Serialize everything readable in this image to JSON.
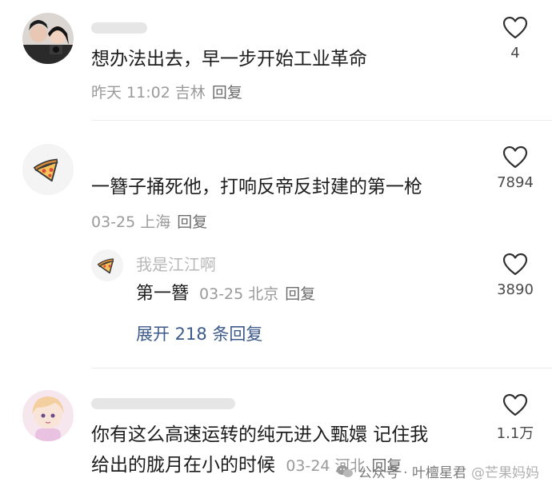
{
  "comments": [
    {
      "content": "想办法出去，早一步开始工业革命",
      "date": "昨天 11:02",
      "location": "吉林",
      "reply_label": "回复",
      "likes": "4",
      "avatar": "couple-photo"
    },
    {
      "content": "一簪子捅死他，打响反帝反封建的第一枪",
      "date": "03-25",
      "location": "上海",
      "reply_label": "回复",
      "likes": "7894",
      "avatar": "pizza-icon",
      "reply": {
        "username": "我是江江啊",
        "content": "第一簪",
        "date": "03-25",
        "location": "北京",
        "reply_label": "回复",
        "likes": "3890",
        "avatar": "pizza-icon"
      },
      "expand_label": "展开 218 条回复"
    },
    {
      "content_line1": "你有这么高速运转的纯元进入甄嬛 记住我",
      "content_line2": "给出的胧月在小的时候",
      "date": "03-24",
      "location": "河北",
      "reply_label": "回复",
      "likes": "1.1万",
      "avatar": "anime-girl"
    }
  ],
  "watermark": {
    "text": "公众号 · 叶檀星君",
    "handle": "@芒果妈妈"
  },
  "colors": {
    "text": "#1c1c1c",
    "meta": "#9a9a9a",
    "link": "#3c5a8c"
  }
}
